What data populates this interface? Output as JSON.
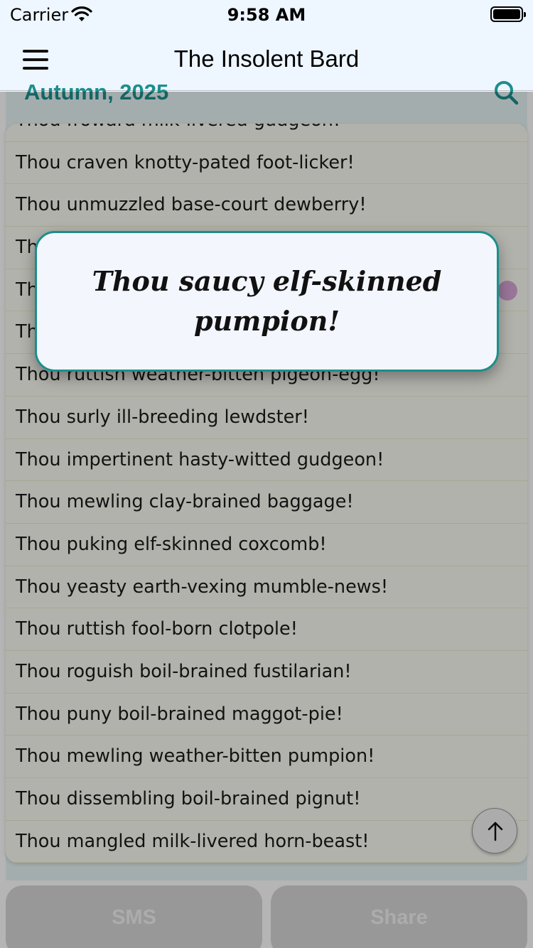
{
  "status_bar": {
    "carrier": "Carrier",
    "time": "9:58 AM",
    "wifi_icon": "wifi-icon",
    "battery_icon": "battery-icon"
  },
  "nav": {
    "title": "The Insolent Bard",
    "menu_icon": "hamburger-menu-icon"
  },
  "section": {
    "title": "Autumn, 2025",
    "search_icon": "search-icon"
  },
  "insults": [
    "Thou froward milk-livered gudgeon!",
    "Thou craven knotty-pated foot-licker!",
    "Thou unmuzzled base-court dewberry!",
    "",
    "",
    "",
    "Thou ruttish weather-bitten pigeon-egg!",
    "Thou surly ill-breeding lewdster!",
    "Thou impertinent hasty-witted gudgeon!",
    "Thou mewling clay-brained baggage!",
    "Thou puking elf-skinned coxcomb!",
    "Thou yeasty earth-vexing mumble-news!",
    "Thou ruttish fool-born clotpole!",
    "Thou roguish boil-brained fustilarian!",
    "Thou puny boil-brained maggot-pie!",
    "Thou mewling weather-bitten pumpion!",
    "Thou dissembling boil-brained pignut!",
    "Thou mangled milk-livered horn-beast!"
  ],
  "partial_rows": [
    "Th",
    "Th",
    "Th"
  ],
  "scroll_top_icon": "arrow-up-icon",
  "buttons": {
    "sms": "SMS",
    "share": "Share"
  },
  "popup": {
    "text": "Thou saucy elf-skinned pumpion!"
  },
  "colors": {
    "accent": "#1b8f8c",
    "nav_background": "#eef6ff",
    "list_background": "#fbfbf3",
    "popup_background": "#f3f6fd"
  }
}
